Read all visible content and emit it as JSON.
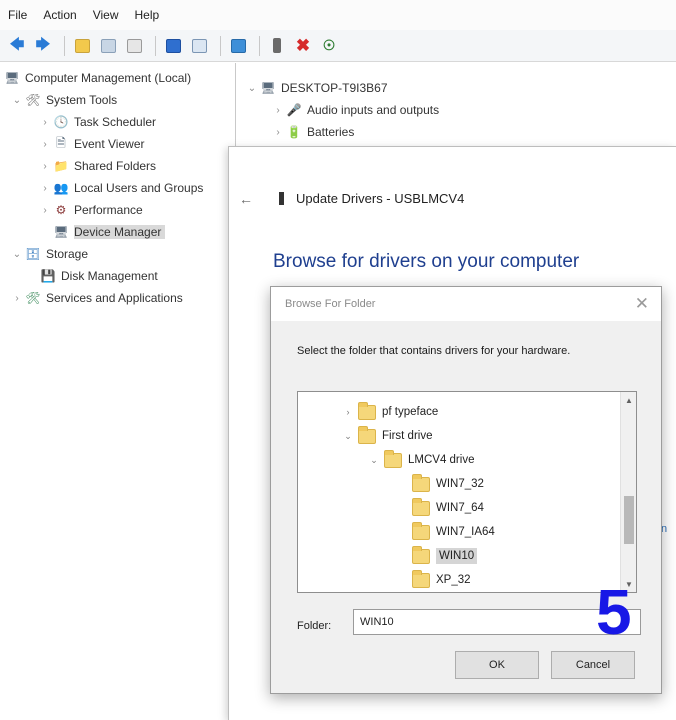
{
  "menu": [
    "File",
    "Action",
    "View",
    "Help"
  ],
  "toolbar": {
    "icons": [
      "back-arrow",
      "forward-arrow",
      "up-folder",
      "show-hide-tree",
      "properties",
      "help",
      "action-pane",
      "monitor",
      "update-driver",
      "uninstall-x",
      "scan-hardware"
    ],
    "colors": {
      "back": "#2a7bd6",
      "forward": "#2a7bd6",
      "x": "#d62a2a"
    }
  },
  "left_tree": {
    "root": "Computer Management (Local)",
    "system_tools": "System Tools",
    "task_scheduler": "Task Scheduler",
    "event_viewer": "Event Viewer",
    "shared_folders": "Shared Folders",
    "local_users": "Local Users and Groups",
    "performance": "Performance",
    "device_manager": "Device Manager",
    "storage": "Storage",
    "disk_management": "Disk Management",
    "services": "Services and Applications"
  },
  "right_tree": {
    "computer": "DESKTOP-T9I3B67",
    "audio": "Audio inputs and outputs",
    "batteries": "Batteries"
  },
  "wizard": {
    "title": "Update Drivers - USBLMCV4",
    "heading": "Browse for drivers on your computer"
  },
  "dialog": {
    "title": "Browse For Folder",
    "instruction": "Select the folder that contains drivers for your hardware.",
    "folders": [
      {
        "name": "pf typeface",
        "selected": false
      },
      {
        "name": "First drive",
        "selected": false
      },
      {
        "name": "LMCV4 drive",
        "selected": false
      },
      {
        "name": "WIN7_32",
        "selected": false
      },
      {
        "name": "WIN7_64",
        "selected": false
      },
      {
        "name": "WIN7_IA64",
        "selected": false
      },
      {
        "name": "WIN10",
        "selected": true
      },
      {
        "name": "XP_32",
        "selected": false
      }
    ],
    "folder_label": "Folder:",
    "folder_value": "WIN10",
    "ok_label": "OK",
    "cancel_label": "Cancel"
  },
  "step_number": "5"
}
